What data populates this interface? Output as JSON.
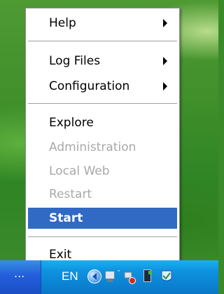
{
  "context_menu": {
    "items": [
      {
        "label": "Help",
        "submenu": true,
        "enabled": true
      },
      {
        "label": "Log Files",
        "submenu": true,
        "enabled": true
      },
      {
        "label": "Configuration",
        "submenu": true,
        "enabled": true
      },
      {
        "label": "Explore",
        "submenu": false,
        "enabled": true
      },
      {
        "label": "Administration",
        "submenu": false,
        "enabled": false
      },
      {
        "label": "Local Web",
        "submenu": false,
        "enabled": false
      },
      {
        "label": "Restart",
        "submenu": false,
        "enabled": false
      },
      {
        "label": "Start",
        "submenu": false,
        "enabled": true,
        "selected": true
      },
      {
        "label": "Exit",
        "submenu": false,
        "enabled": true
      }
    ],
    "selected_color": "#316ac5",
    "disabled_color": "#a8a8a8"
  },
  "taskbar": {
    "overflow": "...",
    "language": "EN",
    "tray_icons": [
      "show-hidden-icons-chevron-icon",
      "network-icon",
      "network-disconnected-icon",
      "document-status-icon",
      "shield-check-icon"
    ],
    "accent_color": "#245edb"
  }
}
